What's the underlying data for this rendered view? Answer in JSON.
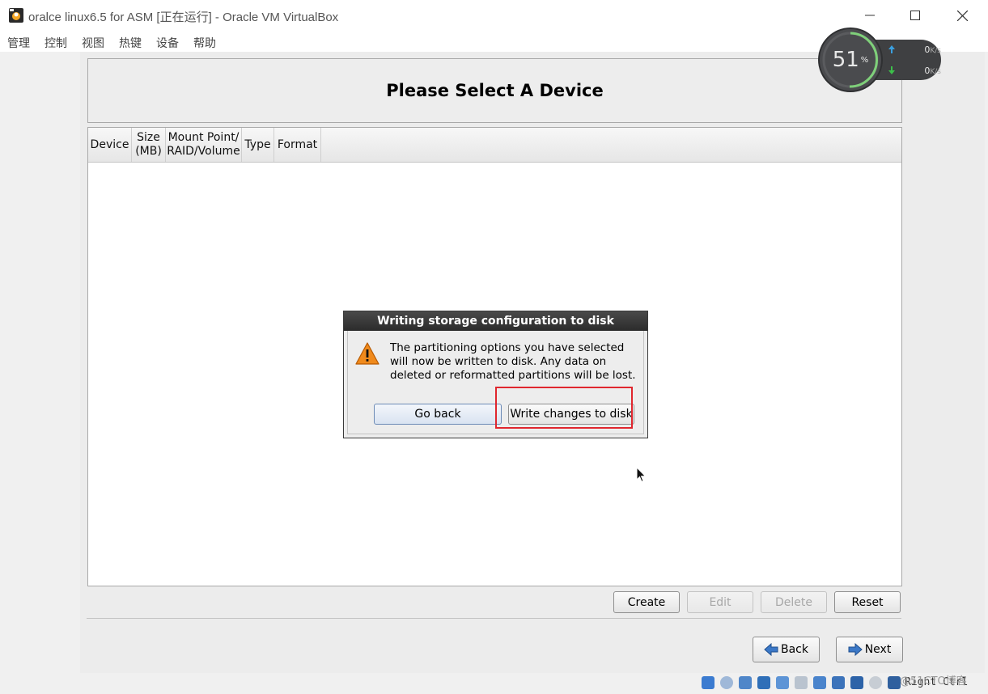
{
  "window": {
    "title": "oralce linux6.5 for ASM [正在运行] - Oracle VM VirtualBox",
    "controls": [
      "minimize",
      "maximize",
      "close"
    ]
  },
  "menu": {
    "items": [
      "管理",
      "控制",
      "视图",
      "热键",
      "设备",
      "帮助"
    ]
  },
  "installer": {
    "header_title": "Please Select A Device",
    "columns": [
      {
        "line1": "Device",
        "line2": ""
      },
      {
        "line1": "Size",
        "line2": "(MB)"
      },
      {
        "line1": "Mount Point/",
        "line2": "RAID/Volume"
      },
      {
        "line1": "Type",
        "line2": ""
      },
      {
        "line1": "Format",
        "line2": ""
      }
    ],
    "rows": [],
    "toolbar": {
      "create": "Create",
      "edit": "Edit",
      "delete": "Delete",
      "reset": "Reset"
    },
    "nav": {
      "back": "Back",
      "next": "Next"
    }
  },
  "dialog": {
    "title": "Writing storage configuration to disk",
    "message": "The partitioning options you have selected will now be written to disk.  Any data on deleted or reformatted partitions will be lost.",
    "go_back": "Go back",
    "write": "Write changes to disk",
    "icon": "warning-icon"
  },
  "net_widget": {
    "percent": "51",
    "percent_unit": "%",
    "upload": "0",
    "download": "0",
    "unit": "K/s"
  },
  "statusbar": {
    "host_key": "Right Ctrl",
    "watermark": "@51CTO博客"
  },
  "colors": {
    "highlight": "#e0262e",
    "dialog_title_bg": "#2b2b2b",
    "upload_arrow": "#3aa0e0",
    "download_arrow": "#3cc04a"
  }
}
